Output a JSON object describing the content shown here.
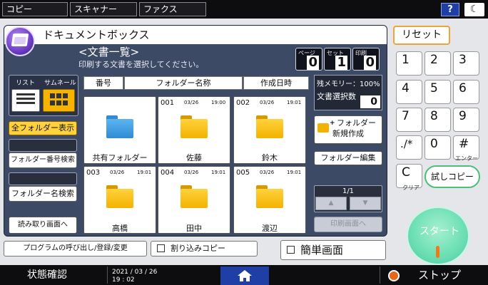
{
  "top_tabs": [
    "コピー",
    "スキャナー",
    "ファクス"
  ],
  "help_label": "?",
  "moon_glyph": "☾",
  "app_title": "ドキュメントボックス",
  "screen_title": "<文書一覧>",
  "screen_subtitle": "印刷する文書を選択してください。",
  "counters": [
    {
      "label": "ページ",
      "value": "0"
    },
    {
      "label": "セット",
      "value": "1"
    },
    {
      "label": "印刷",
      "value": "0"
    }
  ],
  "view_toggle": {
    "list_label": "リスト",
    "thumb_label": "サムネール"
  },
  "left_buttons": {
    "all_folders": "全フォルダー表示",
    "folder_number_search": "フォルダー番号検索",
    "folder_name_search": "フォルダー名検索",
    "read_screen": "読み取り画面へ"
  },
  "columns": {
    "number": "番号",
    "folder_name": "フォルダー名称",
    "created": "作成日時"
  },
  "folders": [
    {
      "num": "",
      "date": "",
      "time": "",
      "name": "共有フォルダー",
      "color": "blue"
    },
    {
      "num": "001",
      "date": "03/26",
      "time": "19:00",
      "name": "佐藤",
      "color": "yellow"
    },
    {
      "num": "002",
      "date": "03/26",
      "time": "19:01",
      "name": "鈴木",
      "color": "yellow"
    },
    {
      "num": "003",
      "date": "03/26",
      "time": "19:01",
      "name": "高橋",
      "color": "yellow"
    },
    {
      "num": "004",
      "date": "03/26",
      "time": "19:01",
      "name": "田中",
      "color": "yellow"
    },
    {
      "num": "005",
      "date": "03/26",
      "time": "19:01",
      "name": "渡辺",
      "color": "yellow"
    }
  ],
  "memory": "残メモリー：100%",
  "selected_count_label": "文書選択数",
  "selected_count": "0",
  "new_folder_line1": "フォルダー",
  "new_folder_line2": "新規作成",
  "edit_folder": "フォルダー編集",
  "page_indicator": "1/1",
  "print_screen": "印刷画面へ",
  "bottom_buttons": {
    "program": "プログラムの呼び出し/登録/変更",
    "interrupt": "割り込みコピー",
    "simple": "簡単画面"
  },
  "status": {
    "label": "状態確認",
    "date": "2021 / 03 / 26",
    "time": "19 : 02",
    "stop": "ストップ"
  },
  "keypad": {
    "reset": "リセット",
    "keys": [
      "1",
      "2",
      "3",
      "4",
      "5",
      "6",
      "7",
      "8",
      "9",
      ".∕*",
      "0",
      "#"
    ],
    "enter_sub": "エンター",
    "clear": "C",
    "clear_sub": "クリア",
    "trial_copy": "試しコピー",
    "start": "スタート"
  },
  "colors": {
    "accent_orange": "#f0a23b",
    "thumb_yellow": "#f6b400",
    "start_green": "#6fe0b6",
    "panel_navy": "#3d4a66"
  }
}
